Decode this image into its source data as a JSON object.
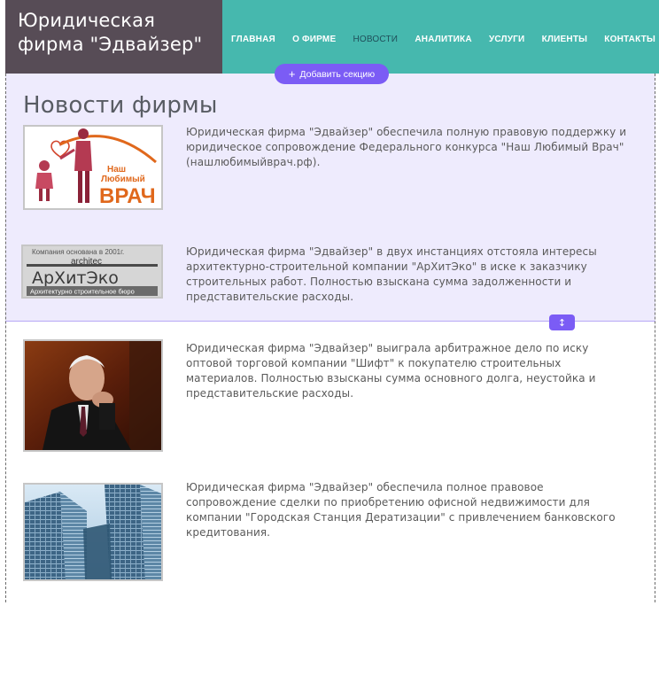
{
  "header": {
    "brand_line1": "Юридическая",
    "brand_line2": "фирма \"Эдвайзер\"",
    "nav": [
      {
        "label": "ГЛАВНАЯ",
        "active": false
      },
      {
        "label": "О ФИРМЕ",
        "active": false
      },
      {
        "label": "НОВОСТИ",
        "active": true
      },
      {
        "label": "АНАЛИТИКА",
        "active": false
      },
      {
        "label": "УСЛУГИ",
        "active": false
      },
      {
        "label": "КЛИЕНТЫ",
        "active": false
      },
      {
        "label": "КОНТАКТЫ",
        "active": false
      }
    ],
    "colors": {
      "brand_bg": "#574c56",
      "nav_bg": "#46b8ae",
      "nav_active": "#1f4f5a"
    }
  },
  "editor": {
    "add_section_label": "Добавить секцию",
    "add_section_icon": "plus-icon",
    "resize_icon": "resize-vertical-icon",
    "accent": "#7b5cf5"
  },
  "page": {
    "title": "Новости фирмы"
  },
  "news": [
    {
      "image": "nash-lyubimyy-vrach-logo",
      "logo_lines": [
        "Наш",
        "Любимый",
        "ВРАЧ"
      ],
      "text": "Юридическая фирма \"Эдвайзер\" обеспечила полную правовую поддержку и юридическое сопровождение Федерального конкурса \"Наш Любимый Врач\" (нашлюбимыйврач.рф)."
    },
    {
      "image": "arkhiteko-logo",
      "logo_lines": [
        "Компания основана в 2001г.",
        "architec",
        "АрХитЭко",
        "Архитектурно строительное бюро"
      ],
      "text": "Юридическая фирма \"Эдвайзер\" в двух инстанциях отстояла интересы архитектурно-строительной компании \"АрХитЭко\" в иске к заказчику строительных работ. Полностью взыскана сумма задолженности и представительские расходы."
    },
    {
      "image": "businessman-portrait-photo",
      "text": "Юридическая фирма \"Эдвайзер\" выиграла арбитражное дело по иску оптовой торговой компании \"Шифт\" к покупателю строительных материалов. Полностью взысканы сумма основного долга, неустойка и представительские расходы."
    },
    {
      "image": "office-buildings-photo",
      "text": "Юридическая фирма \"Эдвайзер\" обеспечила полное правовое сопровождение сделки по приобретению офисной недвижимости для компании \"Городская Станция Дератизации\" с привлечением банковского кредитования."
    }
  ]
}
